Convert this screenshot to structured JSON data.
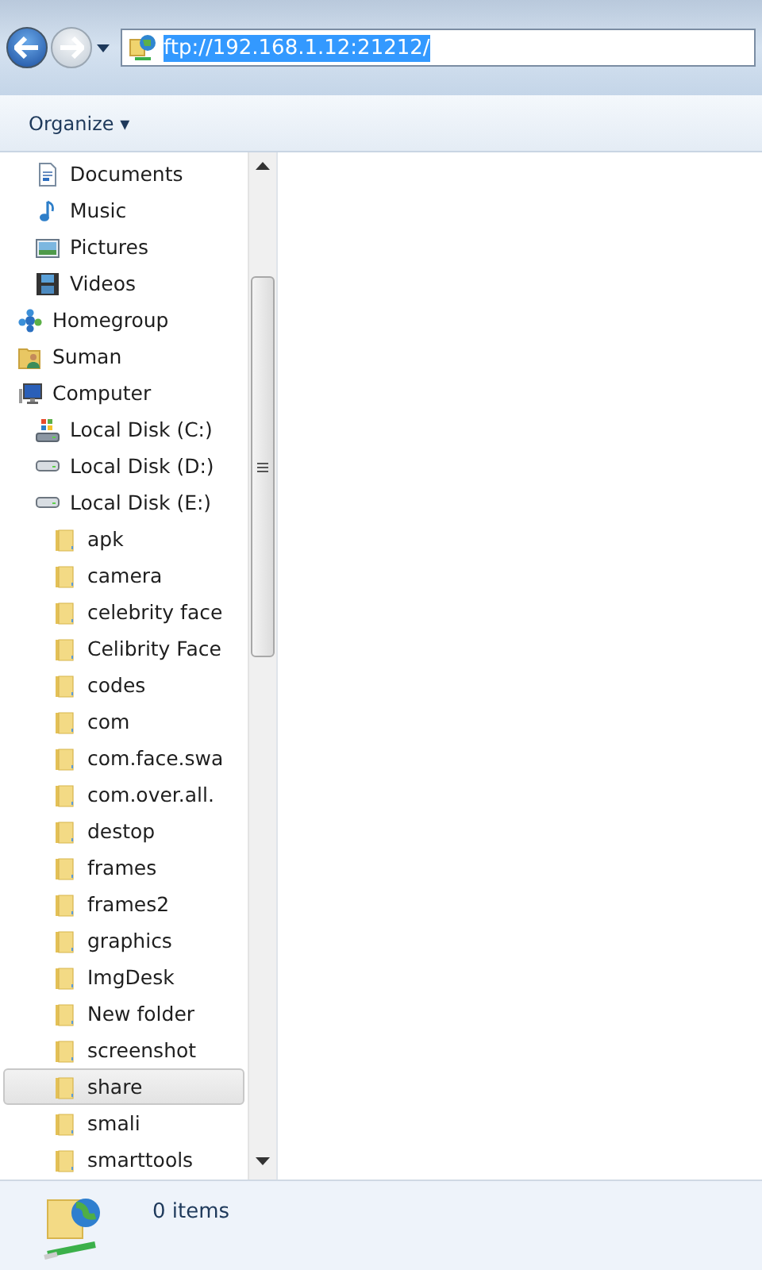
{
  "address_bar": {
    "back_disabled": false,
    "forward_disabled": true,
    "value": "ftp://192.168.1.12:21212/",
    "text_selected": true
  },
  "toolbar": {
    "organize": "Organize ▾"
  },
  "nav_tree": [
    {
      "children": [
        {
          "label": "Documents",
          "kind": "documents",
          "selected": false
        },
        {
          "label": "Music",
          "kind": "music",
          "selected": false
        },
        {
          "label": "Pictures",
          "kind": "pictures",
          "selected": false
        },
        {
          "label": "Videos",
          "kind": "videos",
          "selected": false
        }
      ]
    },
    {
      "label": "Homegroup",
      "kind": "homegroup",
      "selected": false
    },
    {
      "label": "Suman",
      "kind": "user",
      "selected": false
    },
    {
      "label": "Computer",
      "kind": "computer",
      "selected": false,
      "children": [
        {
          "label": "Local Disk (C:)",
          "kind": "system-disk",
          "selected": false
        },
        {
          "label": "Local Disk (D:)",
          "kind": "disk",
          "selected": false
        },
        {
          "label": "Local Disk (E:)",
          "kind": "disk",
          "selected": false,
          "children": [
            {
              "label": "apk",
              "kind": "folder",
              "selected": false
            },
            {
              "label": "camera",
              "kind": "folder",
              "selected": false
            },
            {
              "label": "celebrity face",
              "kind": "folder",
              "selected": false
            },
            {
              "label": "Celibrity Face",
              "kind": "folder",
              "selected": false
            },
            {
              "label": "codes",
              "kind": "folder",
              "selected": false
            },
            {
              "label": "com",
              "kind": "folder",
              "selected": false
            },
            {
              "label": "com.face.swa",
              "kind": "folder",
              "selected": false
            },
            {
              "label": "com.over.all.",
              "kind": "folder",
              "selected": false
            },
            {
              "label": "destop",
              "kind": "folder",
              "selected": false
            },
            {
              "label": "frames",
              "kind": "folder",
              "selected": false
            },
            {
              "label": "frames2",
              "kind": "folder",
              "selected": false
            },
            {
              "label": "graphics",
              "kind": "folder",
              "selected": false
            },
            {
              "label": "ImgDesk",
              "kind": "folder",
              "selected": false
            },
            {
              "label": "New folder",
              "kind": "folder",
              "selected": false
            },
            {
              "label": "screenshot",
              "kind": "folder",
              "selected": false
            },
            {
              "label": "share",
              "kind": "folder",
              "selected": true
            },
            {
              "label": "smali",
              "kind": "folder",
              "selected": false
            },
            {
              "label": "smarttools",
              "kind": "folder",
              "selected": false
            }
          ]
        }
      ]
    }
  ],
  "status_bar": {
    "text": "0 items"
  }
}
